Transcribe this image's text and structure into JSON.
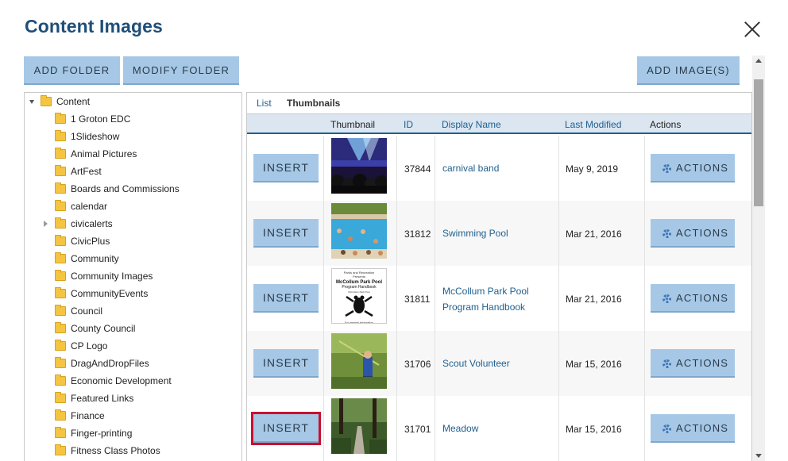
{
  "dialog": {
    "title": "Content Images"
  },
  "toolbar": {
    "add_folder": "ADD FOLDER",
    "modify_folder": "MODIFY FOLDER",
    "add_images": "ADD IMAGE(S)"
  },
  "tree": {
    "root": "Content",
    "folders": [
      "1 Groton EDC",
      "1Slideshow",
      "Animal Pictures",
      "ArtFest",
      "Boards and Commissions",
      "calendar",
      "civicalerts",
      "CivicPlus",
      "Community",
      "Community Images",
      "CommunityEvents",
      "Council",
      "County Council",
      "CP Logo",
      "DragAndDropFiles",
      "Economic Development",
      "Featured Links",
      "Finance",
      "Finger-printing",
      "Fitness Class Photos"
    ]
  },
  "view_tabs": {
    "list": "List",
    "thumbnails": "Thumbnails"
  },
  "table": {
    "headers": {
      "thumbnail": "Thumbnail",
      "id": "ID",
      "display_name": "Display Name",
      "last_modified": "Last Modified",
      "actions": "Actions"
    },
    "insert_label": "INSERT",
    "actions_label": "ACTIONS",
    "rows": [
      {
        "id": "37844",
        "name_line1": "carnival band",
        "name_line2": "",
        "date": "May 9, 2019"
      },
      {
        "id": "31812",
        "name_line1": "Swimming Pool",
        "name_line2": "",
        "date": "Mar 21, 2016"
      },
      {
        "id": "31811",
        "name_line1": "McCollum Park Pool",
        "name_line2": "Program Handbook",
        "date": "Mar 21, 2016"
      },
      {
        "id": "31706",
        "name_line1": "Scout Volunteer",
        "name_line2": "",
        "date": "Mar 15, 2016"
      },
      {
        "id": "31701",
        "name_line1": "Meadow",
        "name_line2": "",
        "date": "Mar 15, 2016"
      }
    ]
  },
  "handbook_thumb": {
    "line1": "Parks and Recreation",
    "line2": "Presents",
    "line3": "McCollum Park Pool",
    "line4": "Program Handbook",
    "line5": "McCollum Park Pool",
    "line6": "For general information",
    "line7": "425-357-6600"
  },
  "colors": {
    "title": "#1f4e79",
    "button": "#a6c8e6",
    "link": "#1f5f8f",
    "highlight": "#c8102e"
  }
}
